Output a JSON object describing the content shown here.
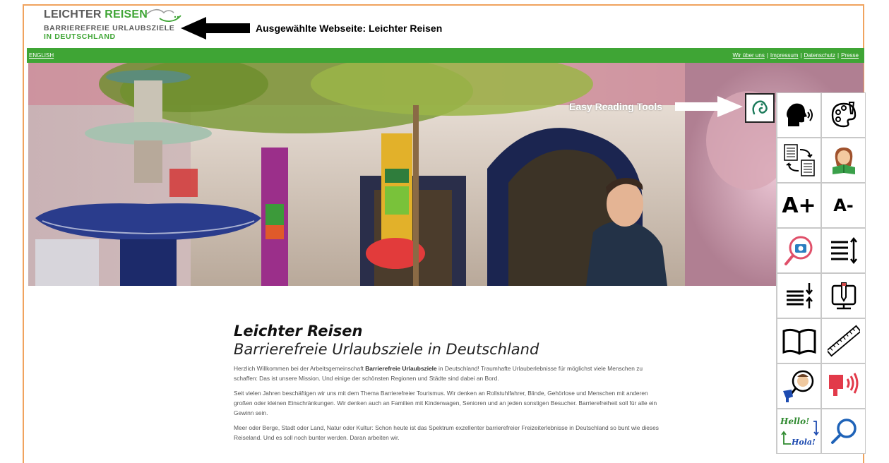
{
  "annotation": {
    "selected_site": "Ausgewählte Webseite: Leichter Reisen",
    "tools_label": "Easy Reading Tools"
  },
  "logo": {
    "line1_a": "LEICHTER",
    "line1_b": "REISEN",
    "line2": "BARRIEREFREIE URLAUBSZIELE",
    "line3": "IN DEUTSCHLAND"
  },
  "nav": {
    "language": "ENGLISH",
    "links": [
      "Wir über uns",
      "Impressum",
      "Datenschutz",
      "Presse"
    ]
  },
  "tools": [
    {
      "name": "text-to-speech-icon",
      "label": ""
    },
    {
      "name": "style-palette-icon",
      "label": ""
    },
    {
      "name": "text-simplify-icon",
      "label": ""
    },
    {
      "name": "reading-person-icon",
      "label": ""
    },
    {
      "name": "font-increase-icon",
      "label": "A+"
    },
    {
      "name": "font-decrease-icon",
      "label": "A-"
    },
    {
      "name": "image-magnifier-icon",
      "label": ""
    },
    {
      "name": "line-height-icon",
      "label": ""
    },
    {
      "name": "line-spacing-icon",
      "label": ""
    },
    {
      "name": "annotation-pencil-icon",
      "label": ""
    },
    {
      "name": "book-icon",
      "label": ""
    },
    {
      "name": "ruler-icon",
      "label": ""
    },
    {
      "name": "symbol-lookup-icon",
      "label": ""
    },
    {
      "name": "speak-aloud-icon",
      "label": ""
    },
    {
      "name": "translate-icon",
      "label": ""
    },
    {
      "name": "search-icon",
      "label": ""
    }
  ],
  "translate_words": {
    "top": "Hello!",
    "bottom": "Hola!"
  },
  "content": {
    "title": "Leichter Reisen",
    "subtitle": "Barrierefreie Urlaubsziele in Deutschland",
    "p1_a": "Herzlich Willkommen bei der Arbeitsgemeinschaft ",
    "p1_bold": "Barrierefreie Urlaubsziele",
    "p1_b": " in Deutschland! Traumhafte Urlauberlebnisse für möglichst viele Menschen zu schaffen: Das ist unsere Mission. Und einige der schönsten Regionen und Städte sind dabei an Bord.",
    "p2": "Seit vielen Jahren beschäftigen wir uns mit dem Thema Barrierefreier Tourismus. Wir denken an Rollstuhlfahrer, Blinde, Gehörlose und Menschen mit anderen großen oder kleinen Einschränkungen. Wir denken auch an Familien mit Kinderwagen, Senioren und an jeden sonstigen Besucher. Barrierefreiheit soll für alle ein Gewinn sein.",
    "p3": "Meer oder Berge, Stadt oder Land, Natur oder Kultur: Schon heute ist das Spektrum exzellenter barrierefreier Freizeiterlebnisse in Deutschland so bunt wie dieses Reiseland. Und es soll noch bunter werden. Daran arbeiten wir."
  },
  "colors": {
    "brand_green": "#3fa535",
    "frame_orange": "#f0a35e"
  }
}
